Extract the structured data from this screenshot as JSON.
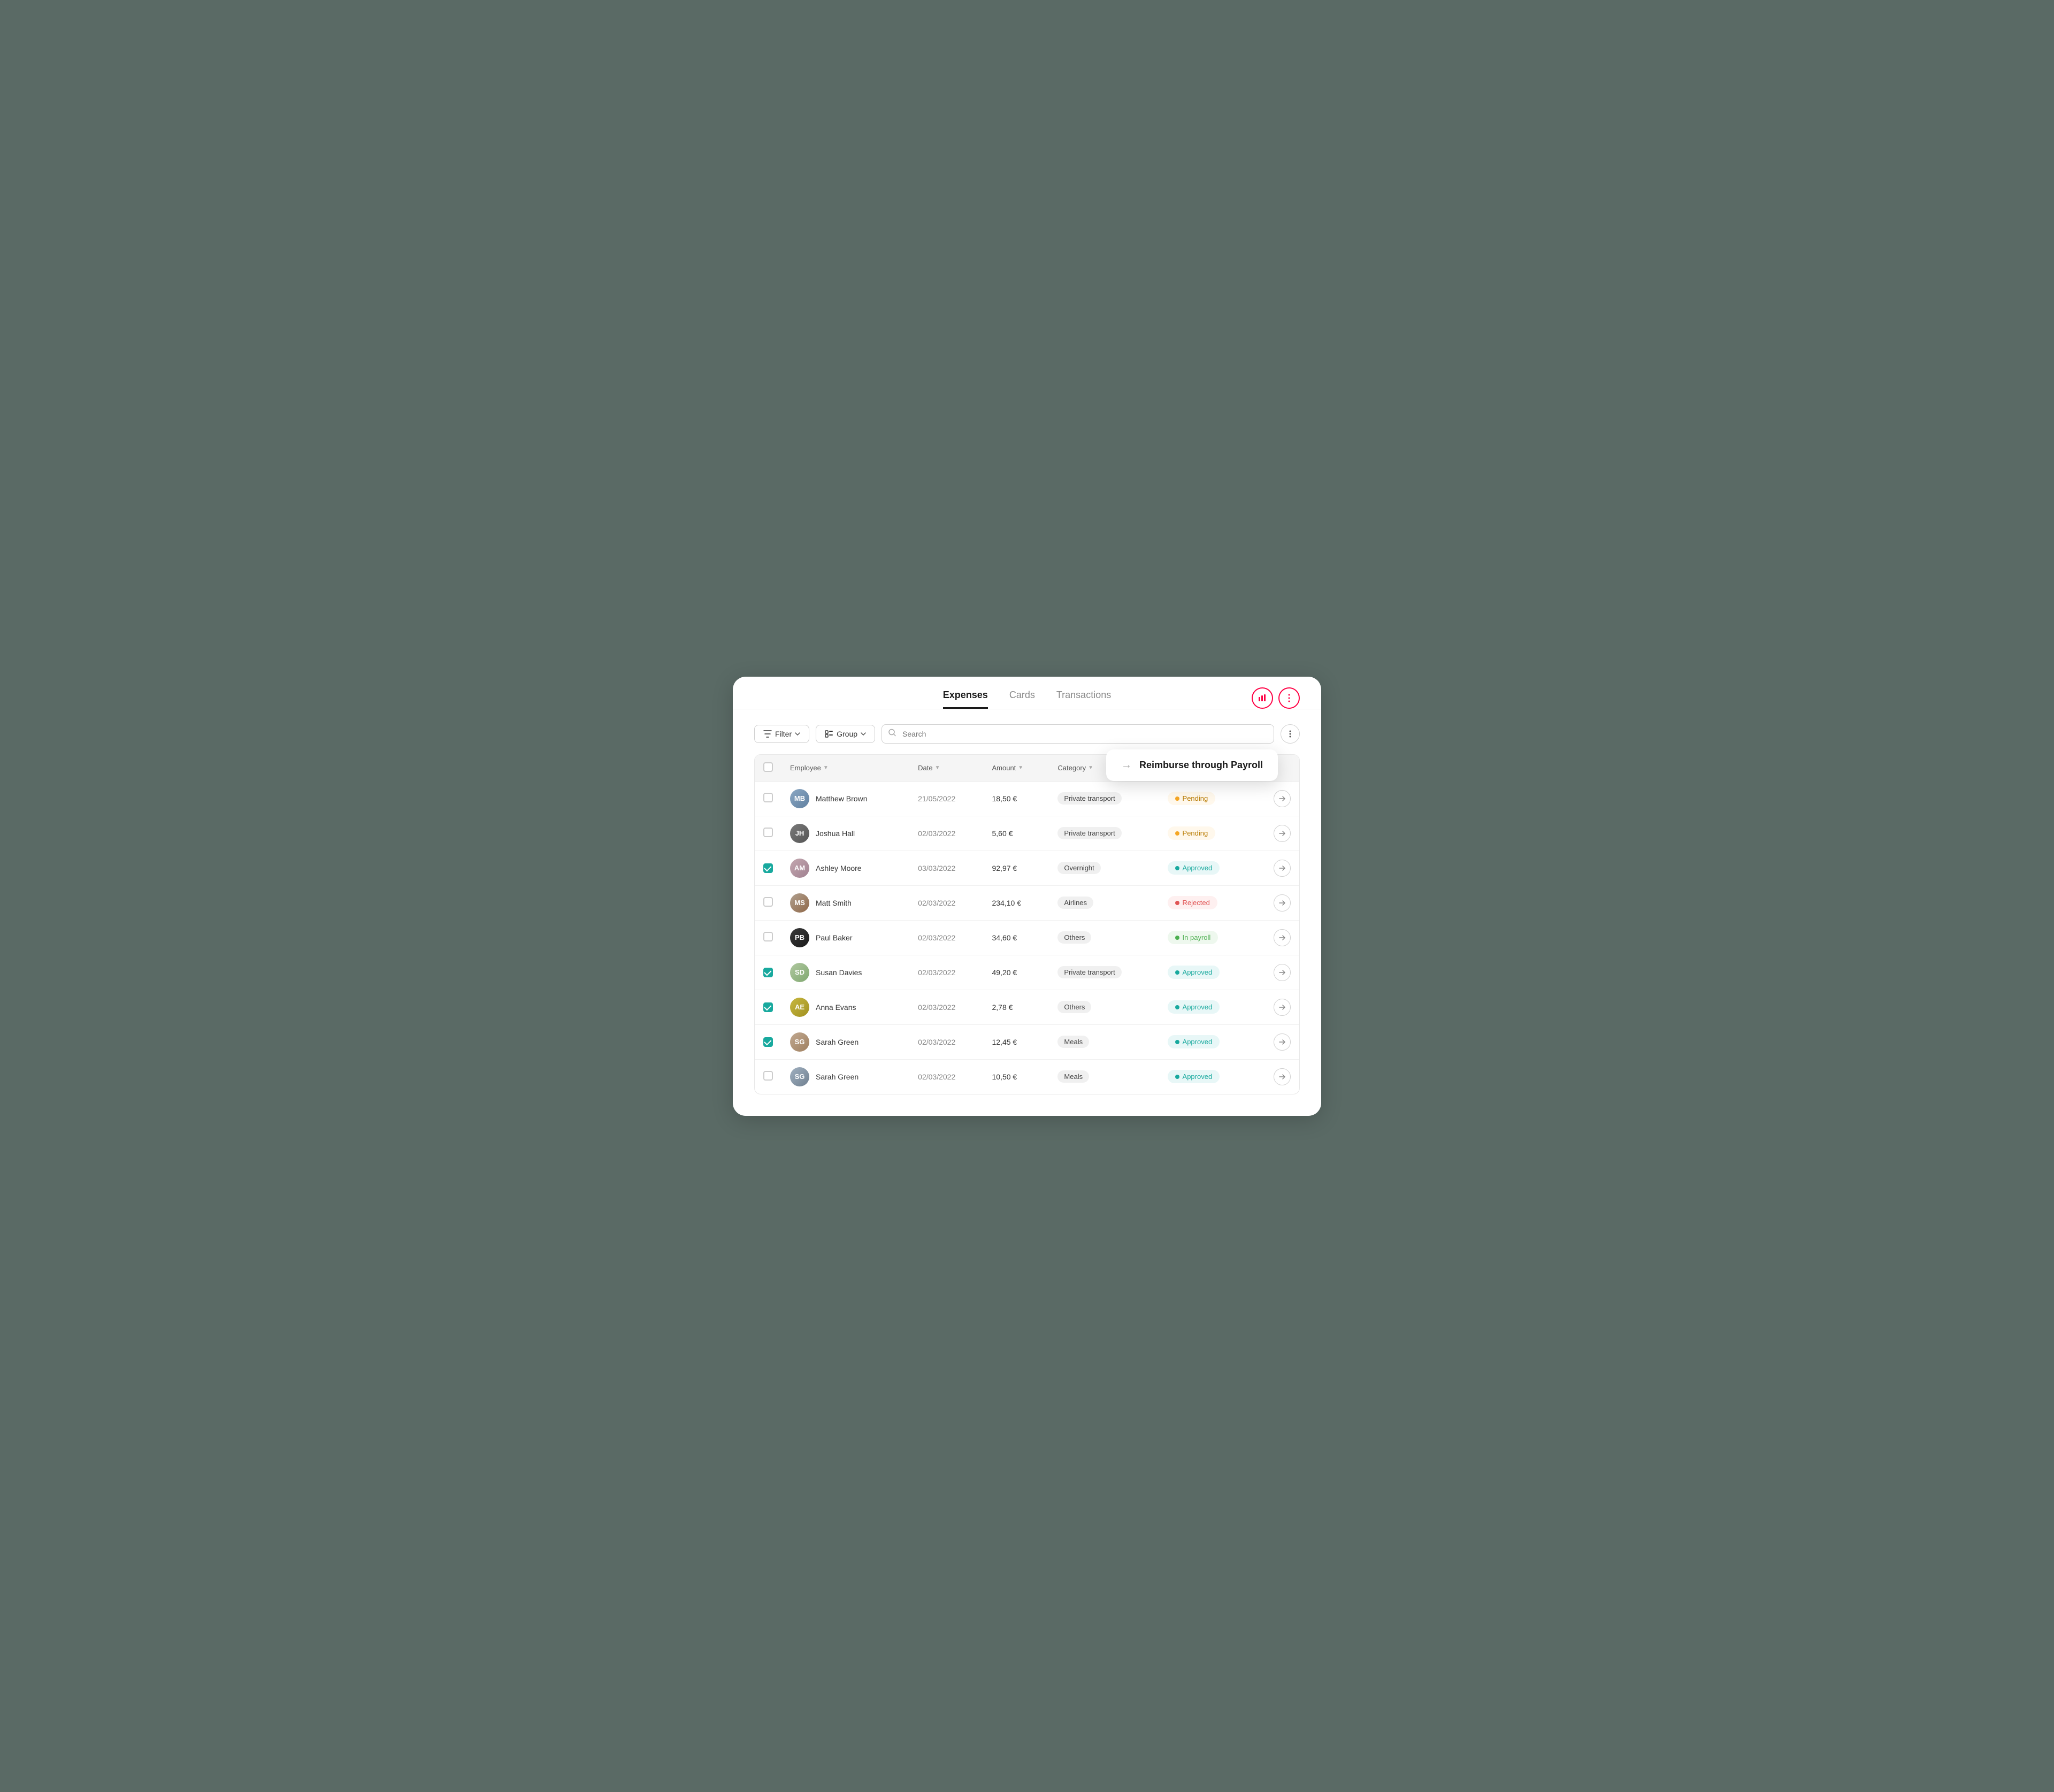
{
  "header": {
    "tabs": [
      {
        "id": "expenses",
        "label": "Expenses",
        "active": true
      },
      {
        "id": "cards",
        "label": "Cards",
        "active": false
      },
      {
        "id": "transactions",
        "label": "Transactions",
        "active": false
      }
    ],
    "actions": [
      {
        "id": "chart-icon",
        "symbol": "▦"
      },
      {
        "id": "more-icon",
        "symbol": "⋮"
      }
    ]
  },
  "toolbar": {
    "filter_label": "Filter",
    "group_label": "Group",
    "search_placeholder": "Search"
  },
  "popup": {
    "arrow": "→",
    "text": "Reimburse through Payroll"
  },
  "table": {
    "columns": [
      {
        "id": "checkbox",
        "label": ""
      },
      {
        "id": "employee",
        "label": "Employee"
      },
      {
        "id": "date",
        "label": "Date"
      },
      {
        "id": "amount",
        "label": "Amount"
      },
      {
        "id": "category",
        "label": "Category"
      },
      {
        "id": "status",
        "label": ""
      },
      {
        "id": "action",
        "label": ""
      }
    ],
    "rows": [
      {
        "id": "row-1",
        "checked": false,
        "avatar_class": "av-mb",
        "avatar_initials": "MB",
        "employee": "Matthew Brown",
        "date": "21/05/2022",
        "amount": "18,50 €",
        "category": "Private transport",
        "status": "Pending",
        "status_class": "status-pending"
      },
      {
        "id": "row-2",
        "checked": false,
        "avatar_class": "av-jh",
        "avatar_initials": "JH",
        "employee": "Joshua Hall",
        "date": "02/03/2022",
        "amount": "5,60 €",
        "category": "Private transport",
        "status": "Pending",
        "status_class": "status-pending"
      },
      {
        "id": "row-3",
        "checked": true,
        "avatar_class": "av-am",
        "avatar_initials": "AM",
        "employee": "Ashley Moore",
        "date": "03/03/2022",
        "amount": "92,97 €",
        "category": "Overnight",
        "status": "Approved",
        "status_class": "status-approved"
      },
      {
        "id": "row-4",
        "checked": false,
        "avatar_class": "av-ms",
        "avatar_initials": "MS",
        "employee": "Matt Smith",
        "date": "02/03/2022",
        "amount": "234,10 €",
        "category": "Airlines",
        "status": "Rejected",
        "status_class": "status-rejected"
      },
      {
        "id": "row-5",
        "checked": false,
        "avatar_class": "av-pb",
        "avatar_initials": "PB",
        "employee": "Paul Baker",
        "date": "02/03/2022",
        "amount": "34,60 €",
        "category": "Others",
        "status": "In payroll",
        "status_class": "status-payroll"
      },
      {
        "id": "row-6",
        "checked": true,
        "avatar_class": "av-sd",
        "avatar_initials": "SD",
        "employee": "Susan Davies",
        "date": "02/03/2022",
        "amount": "49,20 €",
        "category": "Private transport",
        "status": "Approved",
        "status_class": "status-approved"
      },
      {
        "id": "row-7",
        "checked": true,
        "avatar_class": "av-ae",
        "avatar_initials": "AE",
        "employee": "Anna Evans",
        "date": "02/03/2022",
        "amount": "2,78 €",
        "category": "Others",
        "status": "Approved",
        "status_class": "status-approved"
      },
      {
        "id": "row-8",
        "checked": true,
        "avatar_class": "av-sg",
        "avatar_initials": "SG",
        "employee": "Sarah Green",
        "date": "02/03/2022",
        "amount": "12,45 €",
        "category": "Meals",
        "status": "Approved",
        "status_class": "status-approved"
      },
      {
        "id": "row-9",
        "checked": false,
        "avatar_class": "av-sg2",
        "avatar_initials": "SG",
        "employee": "Sarah Green",
        "date": "02/03/2022",
        "amount": "10,50 €",
        "category": "Meals",
        "status": "Approved",
        "status_class": "status-approved"
      }
    ]
  }
}
